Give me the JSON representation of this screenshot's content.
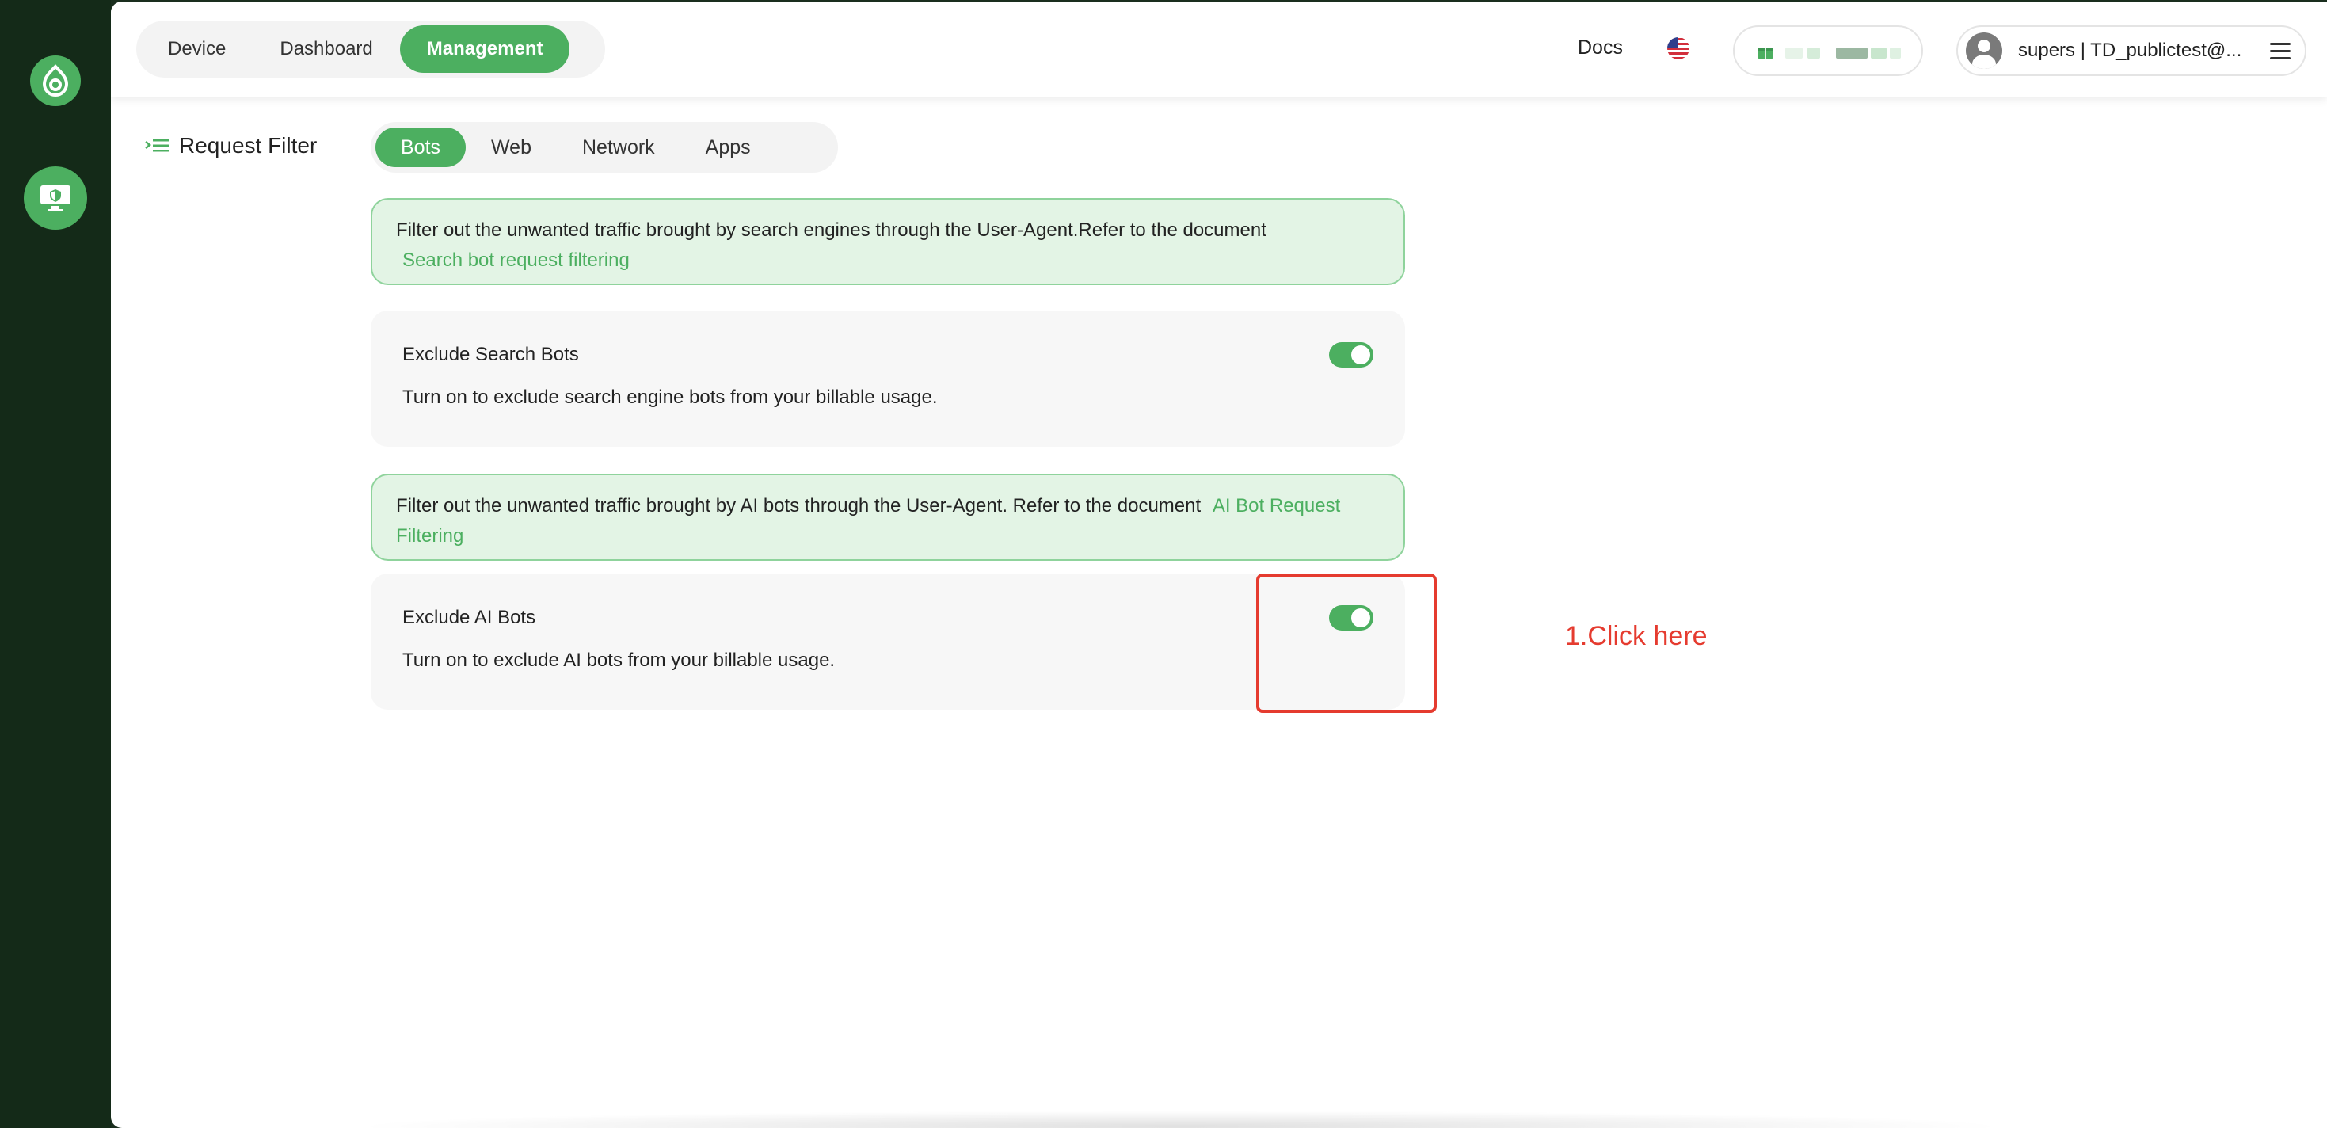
{
  "nav": {
    "tabs": [
      "Device",
      "Dashboard",
      "Management"
    ],
    "active": "Management"
  },
  "header": {
    "docs_label": "Docs",
    "user_label": "supers | TD_publictest@..."
  },
  "page": {
    "title": "Request Filter",
    "tabs": [
      "Bots",
      "Web",
      "Network",
      "Apps"
    ],
    "active_tab": "Bots"
  },
  "search_bots": {
    "info_text": "Filter out the unwanted traffic brought by search engines through the User-Agent.Refer to the document",
    "info_link": "Search bot request filtering",
    "title": "Exclude Search Bots",
    "description": "Turn on to exclude search engine bots from your billable usage.",
    "enabled": true
  },
  "ai_bots": {
    "info_text": "Filter out the unwanted traffic brought by AI bots through the User-Agent. Refer to the document",
    "info_link": "AI Bot Request Filtering",
    "title": "Exclude AI Bots",
    "description": "Turn on to exclude AI bots from your billable usage.",
    "enabled": true
  },
  "annotation": {
    "text": "1.Click here",
    "color": "#e53b2f"
  },
  "colors": {
    "accent": "#4caf60",
    "sidebar": "#142a18",
    "info_bg": "#e3f4e5"
  },
  "icons": {
    "logo": "brand-logo-icon",
    "sidebar_security": "monitor-shield-icon",
    "flag": "us-flag-icon",
    "gift": "gift-icon",
    "avatar": "user-avatar-icon",
    "menu": "hamburger-menu-icon",
    "title": "list-indent-icon"
  }
}
